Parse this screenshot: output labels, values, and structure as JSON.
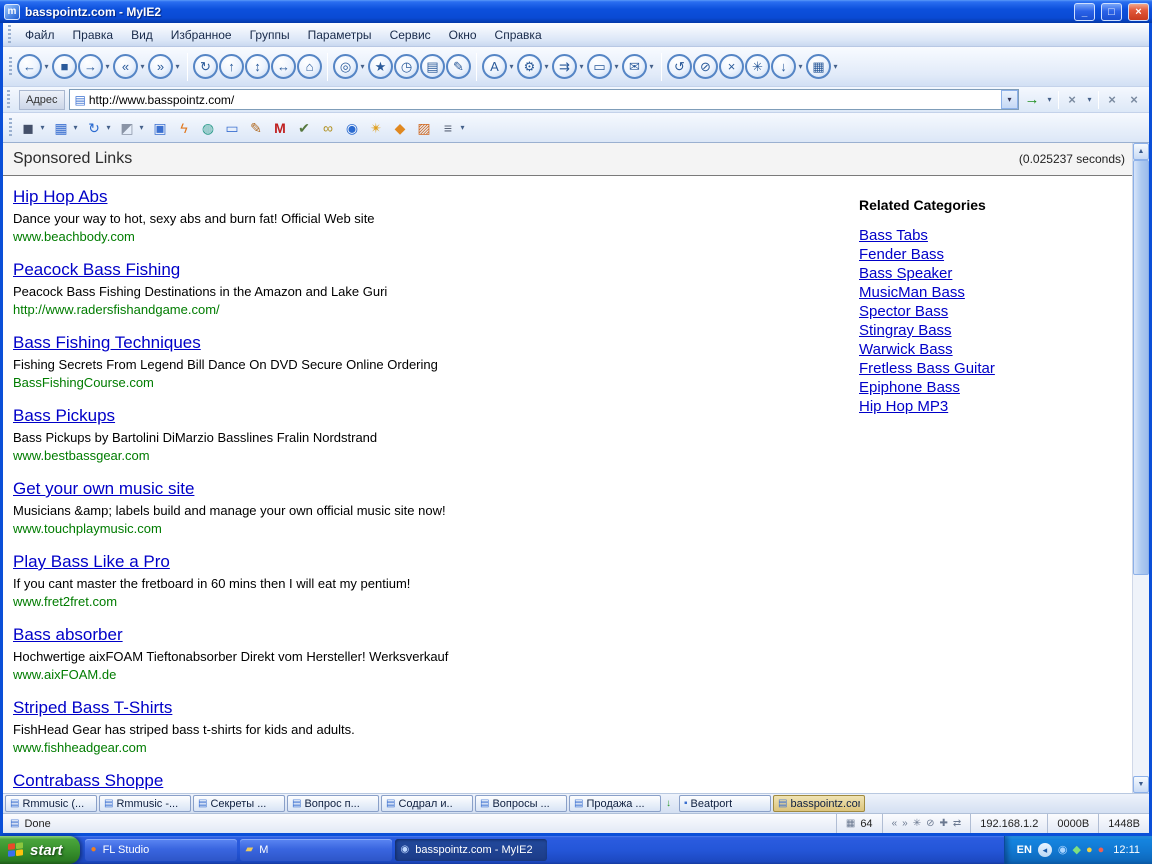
{
  "titlebar": {
    "app_icon_glyph": "m",
    "title": "basspointz.com - MyIE2",
    "minimize_glyph": "_",
    "maximize_glyph": "□",
    "close_glyph": "×"
  },
  "menubar": {
    "items": [
      {
        "name": "menu-file",
        "label": "Файл"
      },
      {
        "name": "menu-edit",
        "label": "Правка"
      },
      {
        "name": "menu-view",
        "label": "Вид"
      },
      {
        "name": "menu-favorites",
        "label": "Избранное"
      },
      {
        "name": "menu-groups",
        "label": "Группы"
      },
      {
        "name": "menu-options",
        "label": "Параметры"
      },
      {
        "name": "menu-tools",
        "label": "Сервис"
      },
      {
        "name": "menu-window",
        "label": "Окно"
      },
      {
        "name": "menu-help",
        "label": "Справка"
      }
    ]
  },
  "toolbar_main": {
    "nav_group": [
      {
        "name": "back-button",
        "glyph": "←",
        "caret": "▾"
      },
      {
        "name": "stop-button",
        "glyph": "■",
        "caret": ""
      },
      {
        "name": "forward-button",
        "glyph": "→",
        "caret": "▾"
      },
      {
        "name": "first-page-button",
        "glyph": "«",
        "caret": "▾"
      },
      {
        "name": "last-page-button",
        "glyph": "»",
        "caret": "▾"
      }
    ],
    "page_group": [
      {
        "name": "refresh-button",
        "glyph": "↻",
        "caret": ""
      },
      {
        "name": "up-button",
        "glyph": "↑",
        "caret": ""
      },
      {
        "name": "sort-tabs-button",
        "glyph": "↕",
        "caret": ""
      },
      {
        "name": "span-button",
        "glyph": "↔",
        "caret": ""
      },
      {
        "name": "home-button",
        "glyph": "⌂",
        "caret": ""
      }
    ],
    "tools_group": [
      {
        "name": "search-button",
        "glyph": "◎",
        "caret": "▾"
      },
      {
        "name": "favorites-button",
        "glyph": "★",
        "caret": ""
      },
      {
        "name": "history-button",
        "glyph": "◷",
        "caret": ""
      },
      {
        "name": "print-button",
        "glyph": "▤",
        "caret": ""
      },
      {
        "name": "edit-button",
        "glyph": "✎",
        "caret": ""
      }
    ],
    "view_group": [
      {
        "name": "font-size-button",
        "glyph": "A",
        "caret": "▾"
      },
      {
        "name": "options-button",
        "glyph": "⚙",
        "caret": "▾"
      },
      {
        "name": "next-link-button",
        "glyph": "⇉",
        "caret": "▾"
      },
      {
        "name": "fullscreen-button",
        "glyph": "▭",
        "caret": "▾"
      },
      {
        "name": "mail-button",
        "glyph": "✉",
        "caret": "▾"
      }
    ],
    "misc_group": [
      {
        "name": "undo-close-button",
        "glyph": "↺",
        "caret": ""
      },
      {
        "name": "block-popup-button",
        "glyph": "⊘",
        "caret": ""
      },
      {
        "name": "close-tab-button",
        "glyph": "×",
        "caret": ""
      },
      {
        "name": "plugins-button",
        "glyph": "✳",
        "caret": ""
      },
      {
        "name": "download-button",
        "glyph": "↓",
        "caret": "▾"
      },
      {
        "name": "panels-button",
        "glyph": "▦",
        "caret": "▾"
      }
    ]
  },
  "addressbar": {
    "label": "Адрес",
    "favicon_glyph": "▤",
    "value": "http://www.basspointz.com/",
    "drop_glyph": "▾",
    "go_glyph": "→",
    "go_caret": "▾",
    "x1": "×",
    "x1_caret": "▾",
    "x2": "×",
    "x3": "×"
  },
  "toolbar_plugins": {
    "items": [
      {
        "name": "save-session-button",
        "glyph": "◼",
        "style": "color:#44506a",
        "caret": "▾"
      },
      {
        "name": "form-fill-button",
        "glyph": "▦",
        "style": "color:#3a6fd0",
        "caret": "▾"
      },
      {
        "name": "auto-refresh-button",
        "glyph": "↻",
        "style": "color:#2a6ad0",
        "caret": "▾"
      },
      {
        "name": "clean-button",
        "glyph": "◩",
        "style": "color:#8a94a6",
        "caret": "▾"
      },
      {
        "name": "save-page-button",
        "glyph": "▣",
        "style": "color:#3a6fd0",
        "caret": ""
      },
      {
        "name": "flashget-button",
        "glyph": "ϟ",
        "style": "color:#e07820",
        "caret": ""
      },
      {
        "name": "resources-button",
        "glyph": "◍",
        "style": "color:#2a9a8a",
        "caret": ""
      },
      {
        "name": "capture-button",
        "glyph": "▭",
        "style": "color:#3a6fd0",
        "caret": ""
      },
      {
        "name": "compose-button",
        "glyph": "✎",
        "style": "color:#b06820",
        "caret": ""
      },
      {
        "name": "macro-button",
        "glyph": "M",
        "style": "color:#c02020;font-weight:bold",
        "caret": ""
      },
      {
        "name": "checklist-button",
        "glyph": "✔",
        "style": "color:#56783f",
        "caret": ""
      },
      {
        "name": "links-button",
        "glyph": "∞",
        "style": "color:#b09020",
        "caret": ""
      },
      {
        "name": "globe-button",
        "glyph": "◉",
        "style": "color:#2a6ad0",
        "caret": ""
      },
      {
        "name": "gesture-button",
        "glyph": "✴",
        "style": "color:#e0a020",
        "caret": ""
      },
      {
        "name": "diamond-button",
        "glyph": "◆",
        "style": "color:#e08820",
        "caret": ""
      },
      {
        "name": "images-button",
        "glyph": "▨",
        "style": "color:#d06820",
        "caret": ""
      },
      {
        "name": "list-button",
        "glyph": "≡",
        "style": "color:#5a6478",
        "caret": "▾"
      }
    ]
  },
  "page": {
    "header": "Sponsored Links",
    "timing": "(0.025237 seconds)",
    "links": [
      {
        "name": "ad-hip-hop-abs",
        "title": "Hip Hop Abs",
        "desc": "Dance your way to hot, sexy abs and burn fat! Official Web site",
        "url": "www.beachbody.com"
      },
      {
        "name": "ad-peacock-bass-fishing",
        "title": "Peacock Bass Fishing",
        "desc": "Peacock Bass Fishing Destinations in the Amazon and Lake Guri",
        "url": "http://www.radersfishandgame.com/"
      },
      {
        "name": "ad-bass-fishing-techniques",
        "title": "Bass Fishing Techniques",
        "desc": "Fishing Secrets From Legend Bill Dance On DVD Secure Online Ordering",
        "url": "BassFishingCourse.com"
      },
      {
        "name": "ad-bass-pickups",
        "title": "Bass Pickups",
        "desc": "Bass Pickups by Bartolini DiMarzio Basslines Fralin Nordstrand",
        "url": "www.bestbassgear.com"
      },
      {
        "name": "ad-get-your-own-music-site",
        "title": "Get your own music site",
        "desc": "Musicians &amp; labels build and manage your own official music site now!",
        "url": "www.touchplaymusic.com"
      },
      {
        "name": "ad-play-bass-like-a-pro",
        "title": "Play Bass Like a Pro",
        "desc": "If you cant master the fretboard in 60 mins then I will eat my pentium!",
        "url": "www.fret2fret.com"
      },
      {
        "name": "ad-bass-absorber",
        "title": "Bass absorber",
        "desc": "Hochwertige aixFOAM Tieftonabsorber Direkt vom Hersteller! Werksverkauf",
        "url": "www.aixFOAM.de"
      },
      {
        "name": "ad-striped-bass-t-shirts",
        "title": "Striped Bass T-Shirts",
        "desc": "FishHead Gear has striped bass t-shirts for kids and adults.",
        "url": "www.fishheadgear.com"
      },
      {
        "name": "ad-contrabass-shoppe",
        "title": "Contrabass Shoppe",
        "desc": "",
        "url": ""
      }
    ],
    "related": {
      "header": "Related Categories",
      "items": [
        {
          "name": "related-bass-tabs",
          "label": "Bass Tabs"
        },
        {
          "name": "related-fender-bass",
          "label": "Fender Bass"
        },
        {
          "name": "related-bass-speaker",
          "label": "Bass Speaker"
        },
        {
          "name": "related-musicman-bass",
          "label": "MusicMan Bass"
        },
        {
          "name": "related-spector-bass",
          "label": "Spector Bass"
        },
        {
          "name": "related-stingray-bass",
          "label": "Stingray Bass"
        },
        {
          "name": "related-warwick-bass",
          "label": "Warwick Bass"
        },
        {
          "name": "related-fretless-bass-guitar",
          "label": "Fretless Bass Guitar"
        },
        {
          "name": "related-epiphone-bass",
          "label": "Epiphone Bass"
        },
        {
          "name": "related-hip-hop-mp3",
          "label": "Hip Hop MP3"
        }
      ]
    }
  },
  "scrollbar": {
    "up": "▲",
    "down": "▼"
  },
  "tabbar": {
    "tabs": [
      {
        "name": "tab-rmmusic-1",
        "glyph": "▤",
        "ico_style": "color:#3a6fd0",
        "label": "Rmmusic (...",
        "active": false,
        "kind": "tab"
      },
      {
        "name": "tab-rmmusic-2",
        "glyph": "▤",
        "ico_style": "color:#3a6fd0",
        "label": "Rmmusic -...",
        "active": false,
        "kind": "tab"
      },
      {
        "name": "tab-sekrety",
        "glyph": "▤",
        "ico_style": "color:#3a6fd0",
        "label": "Секреты ...",
        "active": false,
        "kind": "tab"
      },
      {
        "name": "tab-vopros",
        "glyph": "▤",
        "ico_style": "color:#3a6fd0",
        "label": "Вопрос п...",
        "active": false,
        "kind": "tab"
      },
      {
        "name": "tab-sodral",
        "glyph": "▤",
        "ico_style": "color:#3a6fd0",
        "label": "Содрал и..",
        "active": false,
        "kind": "tab"
      },
      {
        "name": "tab-voprosy",
        "glyph": "▤",
        "ico_style": "color:#3a6fd0",
        "label": "Вопросы ...",
        "active": false,
        "kind": "tab"
      },
      {
        "name": "tab-prodazha",
        "glyph": "▤",
        "ico_style": "color:#3a6fd0",
        "label": "Продажа ...",
        "active": false,
        "kind": "tab"
      },
      {
        "name": "download-indicator-icon",
        "glyph": "↓",
        "ico_style": "color:#2a9a2a;font-weight:bold",
        "label": "",
        "active": false,
        "kind": "icon"
      },
      {
        "name": "tab-beatport",
        "glyph": "▪",
        "ico_style": "color:#3a6fd0",
        "label": "Beatport",
        "active": false,
        "kind": "tab"
      },
      {
        "name": "tab-basspointz",
        "glyph": "▤",
        "ico_style": "color:#3a6fd0",
        "label": "basspointz.com",
        "active": true,
        "kind": "tab"
      }
    ]
  },
  "statusbar": {
    "doc_glyph": "▤",
    "left_text": "Done",
    "speed_glyph": "▦",
    "speed": "64",
    "icons": [
      {
        "name": "status-back-icon",
        "glyph": "«"
      },
      {
        "name": "status-forward-icon",
        "glyph": "»"
      },
      {
        "name": "status-plugins-icon",
        "glyph": "✳"
      },
      {
        "name": "status-block-icon",
        "glyph": "⊘"
      },
      {
        "name": "status-add-icon",
        "glyph": "✚"
      },
      {
        "name": "status-transfer-icon",
        "glyph": "⇄"
      }
    ],
    "ip": "192.168.1.2",
    "sent": "0000B",
    "received": "1448B"
  },
  "taskbar": {
    "start_label": "start",
    "tasks": [
      {
        "name": "task-fl-studio",
        "icon_glyph": "●",
        "icon_style": "color:#f08020",
        "label": "FL Studio",
        "active": false
      },
      {
        "name": "task-m-folder",
        "icon_glyph": "▰",
        "icon_style": "color:#ecc95c",
        "label": "M",
        "active": false
      },
      {
        "name": "task-basspointz",
        "icon_glyph": "◉",
        "icon_style": "color:#bcd6ff",
        "label": "basspointz.com - MyIE2",
        "active": true
      }
    ],
    "tray": {
      "lang": "EN",
      "chevron_glyph": "◂",
      "icons": [
        {
          "name": "tray-browser-icon",
          "glyph": "◉",
          "style": "color:#a8d4ff"
        },
        {
          "name": "tray-green-icon",
          "glyph": "◆",
          "style": "color:#7fe07f"
        },
        {
          "name": "tray-yellow-icon",
          "glyph": "●",
          "style": "color:#f0d040"
        },
        {
          "name": "tray-red-icon",
          "glyph": "●",
          "style": "color:#f06050"
        }
      ],
      "clock": "12:11"
    }
  }
}
